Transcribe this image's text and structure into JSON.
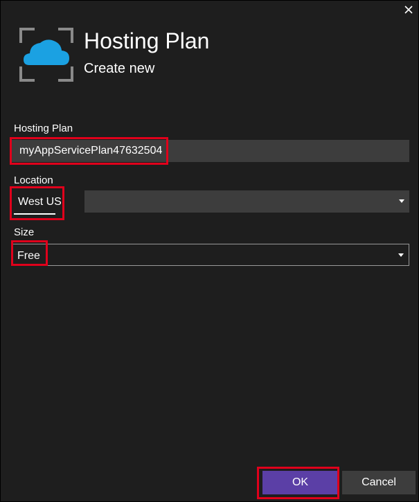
{
  "dialog": {
    "title": "Hosting Plan",
    "subtitle": "Create new",
    "header_icon": "cloud-icon",
    "close_icon": "close-icon"
  },
  "fields": {
    "hosting_plan": {
      "label": "Hosting Plan",
      "value": "myAppServicePlan47632504"
    },
    "location": {
      "label": "Location",
      "value": "West US"
    },
    "size": {
      "label": "Size",
      "value": "Free"
    }
  },
  "buttons": {
    "ok": "OK",
    "cancel": "Cancel"
  },
  "colors": {
    "background": "#1e1e1e",
    "input_background": "#3d3d3d",
    "primary_button": "#5b3fa6",
    "highlight": "#e0001b",
    "cloud_accent": "#1ba1e2"
  }
}
